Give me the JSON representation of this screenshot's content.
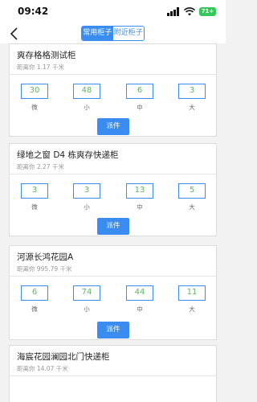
{
  "status_bar": {
    "time": "09:42",
    "battery": "71+"
  },
  "nav": {
    "tabs": [
      {
        "label": "常用柜子",
        "active": true
      },
      {
        "label": "附近柜子",
        "active": false
      }
    ]
  },
  "colors": {
    "accent": "#3b8cf0",
    "count_text": "#5fb85f"
  },
  "slot_labels": [
    "微",
    "小",
    "中",
    "大"
  ],
  "dispatch_label": "派件",
  "cards": [
    {
      "title": "爽存格格测试柜",
      "distance": "距离你 1.17 千米",
      "counts": [
        "30",
        "48",
        "6",
        "3"
      ]
    },
    {
      "title": "绿地之窗 D4 栋爽存快递柜",
      "distance": "距离你 2.27 千米",
      "counts": [
        "3",
        "3",
        "13",
        "5"
      ]
    },
    {
      "title": "河源长鸿花园A",
      "distance": "距离你 995.79 千米",
      "counts": [
        "6",
        "74",
        "44",
        "11"
      ]
    },
    {
      "title": "海宸花园澜园北门快递柜",
      "distance": "距离你 14.07 千米",
      "counts": []
    }
  ]
}
